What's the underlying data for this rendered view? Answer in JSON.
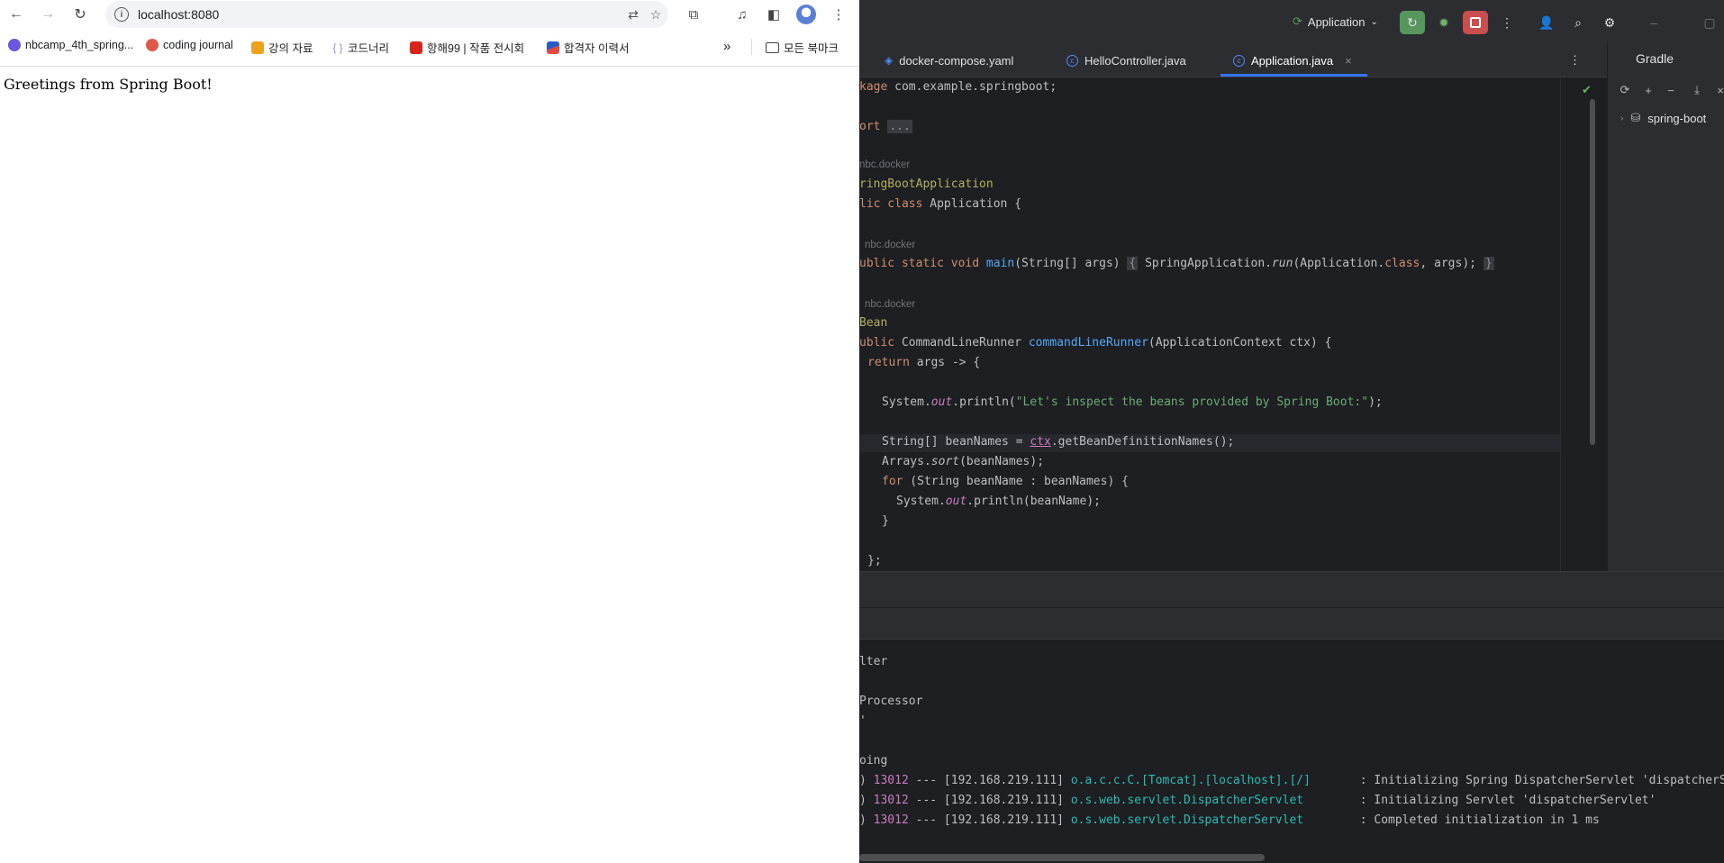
{
  "browser": {
    "url": "localhost:8080",
    "bookmarks": [
      {
        "label": "nbcamp_4th_spring..."
      },
      {
        "label": "coding journal"
      },
      {
        "label": "강의 자료"
      },
      {
        "label": "코드너리"
      },
      {
        "label": "항해99 | 작품 전시회"
      },
      {
        "label": "합격자 이력서"
      }
    ],
    "all_bookmarks_label": "모든 북마크",
    "page_text": "Greetings from Spring Boot!"
  },
  "ide": {
    "run_config": "Application",
    "tabs": [
      {
        "label": "docker-compose.yaml",
        "active": false
      },
      {
        "label": "HelloController.java",
        "active": false
      },
      {
        "label": "Application.java",
        "active": true
      }
    ],
    "gradle_title": "Gradle",
    "gradle_project": "spring-boot",
    "code": {
      "l1_kw": "kage",
      "l1_rest": " com.example.springboot;",
      "l2_kw": "ort",
      "l2_fold": "...",
      "author1": "nbc.docker",
      "l3_an": "ringBootApplication",
      "l4_kw": "lic class",
      "l4_rest": " Application {",
      "author2": "nbc.docker",
      "l5_kw": "ublic static void",
      "l5_fn": "main",
      "l5_rest": "(String[] args) ",
      "l5_fold1": "{",
      "l5_body1": " SpringApplication.",
      "l5_run": "run",
      "l5_body2": "(Application.",
      "l5_class": "class",
      "l5_body3": ", args); ",
      "l5_fold2": "}",
      "author3": "nbc.docker",
      "l6_an": "Bean",
      "l7_kw": "ublic",
      "l7_rest1": " CommandLineRunner ",
      "l7_fn": "commandLineRunner",
      "l7_rest2": "(ApplicationContext ctx) {",
      "l8_kw": "return",
      "l8_rest": " args -> {",
      "l9_a": "System.",
      "l9_out": "out",
      "l9_b": ".println(",
      "l9_str": "\"Let's inspect the beans provided by Spring Boot:\"",
      "l9_c": ");",
      "l10_a": "String[] beanNames = ",
      "l10_ctx": "ctx",
      "l10_b": ".getBeanDefinitionNames();",
      "l11_a": "Arrays.",
      "l11_sort": "sort",
      "l11_b": "(beanNames);",
      "l12_kw": "for",
      "l12_rest": " (String beanName : beanNames) {",
      "l13_a": "System.",
      "l13_out": "out",
      "l13_b": ".println(beanName);",
      "l14": "}",
      "l15": "};"
    },
    "console": {
      "c1": "lter",
      "c2": "Processor",
      "c3": "'",
      "c4": "oing",
      "rows": [
        {
          "pid": "13012",
          "host": " --- [192.168.219.111] ",
          "logger": "o.a.c.c.C.[Tomcat].[localhost].[/]      ",
          "msg": " : Initializing Spring DispatcherServlet 'dispatcherServlet'"
        },
        {
          "pid": "13012",
          "host": " --- [192.168.219.111] ",
          "logger": "o.s.web.servlet.DispatcherServlet       ",
          "msg": " : Initializing Servlet 'dispatcherServlet'"
        },
        {
          "pid": "13012",
          "host": " --- [192.168.219.111] ",
          "logger": "o.s.web.servlet.DispatcherServlet       ",
          "msg": " : Completed initialization in 1 ms"
        }
      ]
    }
  },
  "colors": {
    "accent": "#3574f0",
    "run_green": "#57965c",
    "stop_red": "#c94f4f"
  }
}
